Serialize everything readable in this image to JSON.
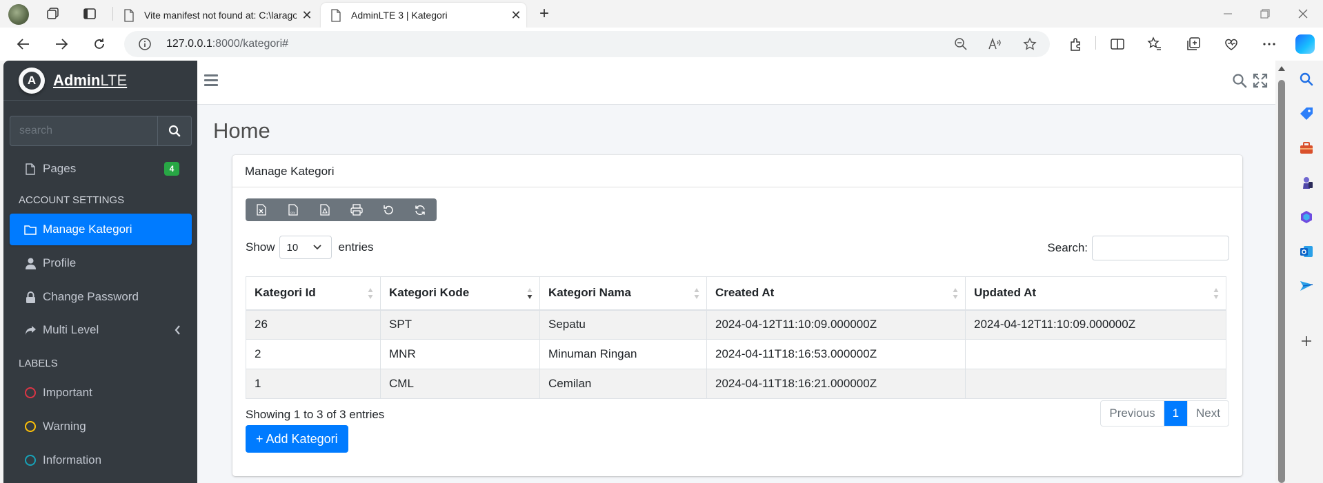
{
  "browser": {
    "tabs": [
      {
        "title": "Vite manifest not found at: C:\\laragon\\www"
      },
      {
        "title": "AdminLTE 3 | Kategori"
      }
    ],
    "url_host": "127.0.0.1",
    "url_path": ":8000/kategori#"
  },
  "brand": {
    "bold": "Admin",
    "light": "LTE"
  },
  "sidebar": {
    "search_placeholder": "search",
    "pages": {
      "label": "Pages",
      "badge": "4"
    },
    "header_account": "ACCOUNT SETTINGS",
    "items": [
      {
        "label": "Manage Kategori",
        "icon": "folder-icon"
      },
      {
        "label": "Profile",
        "icon": "user-icon"
      },
      {
        "label": "Change Password",
        "icon": "lock-icon"
      },
      {
        "label": "Multi Level",
        "icon": "share-icon"
      }
    ],
    "header_labels": "LABELS",
    "labels": [
      {
        "label": "Important",
        "color": "#dc3545"
      },
      {
        "label": "Warning",
        "color": "#ffc107"
      },
      {
        "label": "Information",
        "color": "#17a2b8"
      }
    ]
  },
  "page": {
    "title": "Home"
  },
  "card": {
    "title": "Manage Kategori",
    "show_label": "Show",
    "entries_value": "10",
    "entries_label": "entries",
    "search_label": "Search:",
    "columns": [
      "Kategori Id",
      "Kategori Kode",
      "Kategori Nama",
      "Created At",
      "Updated At"
    ],
    "rows": [
      [
        "26",
        "SPT",
        "Sepatu",
        "2024-04-12T11:10:09.000000Z",
        "2024-04-12T11:10:09.000000Z"
      ],
      [
        "2",
        "MNR",
        "Minuman Ringan",
        "2024-04-11T18:16:53.000000Z",
        ""
      ],
      [
        "1",
        "CML",
        "Cemilan",
        "2024-04-11T18:16:21.000000Z",
        ""
      ]
    ],
    "info": "Showing 1 to 3 of 3 entries",
    "pager": {
      "prev": "Previous",
      "current": "1",
      "next": "Next"
    },
    "add_button": "+ Add Kategori"
  }
}
